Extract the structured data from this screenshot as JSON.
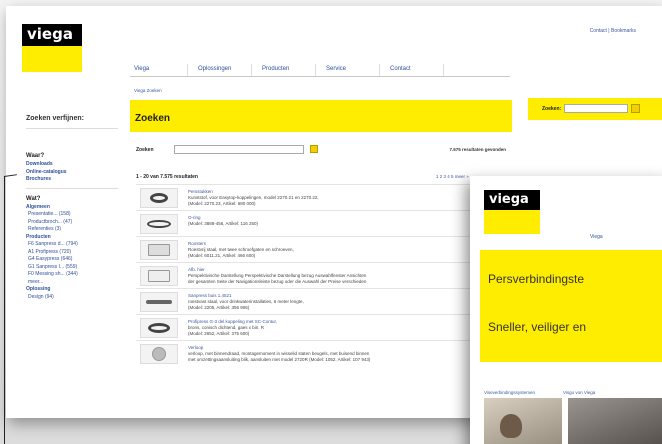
{
  "toplinks": "Contact | Bookmarks",
  "nav": [
    "Viega",
    "Oplossingen",
    "Producten",
    "Service",
    "Contact"
  ],
  "breadcrumb": "Viega Zoeken",
  "sidebar": {
    "heading": "Zoeken verfijnen:"
  },
  "band": {
    "title": "Zoeken",
    "right_label": "Zoeken:"
  },
  "search": {
    "label": "Zoeken",
    "result_count": "7.575 resultaten gevonden"
  },
  "results_header": {
    "range": "1 - 20 van 7.575 resultaten",
    "pager": "1 2 3 4 5 meer »"
  },
  "results": [
    {
      "title": "Persstukken",
      "desc": "Kunststof, voor Easytop-koppelingen, model 2270.21 en 2270.22,",
      "desc2": "(Model: 2270.23, Artikel: 680 000)"
    },
    {
      "title": "O-ring",
      "desc": "(Model: 3888-456, Artikel: 116 250)",
      "desc2": ""
    },
    {
      "title": "Roosters",
      "desc": "Roestvrij staal, met twee schroefgaten en schroeven,",
      "desc2": "(Model: 6011.21, Artikel: 466 600)"
    },
    {
      "title": "Afb. hier",
      "desc": "Perspektivische Darstellung Perspektivische Darstellung bezug Auswahlfenster Ansichten",
      "desc2": "der gesamten Seite der Navigationsleiste bezug oder die Auswahl der Preise verschieden"
    },
    {
      "title": "Sanpress buis 1.4521",
      "desc": "roestvast staal, voor drinkwaterinstallaties, 6 meter lengte,",
      "desc2": "(Model: 2205, Artikel: 356 906)"
    },
    {
      "title": "Profipress G-3 del koppeling met SC-Contur,",
      "desc": "brons, conisch dichtend, gaes x bin. R",
      "desc2": "(Model: 2652, Artikel: 375 600)"
    },
    {
      "title": "Verloop",
      "desc": "verloop, met binnendraad, montagemoment in wisselid staten beugels, met buisend binnen",
      "desc2": "met omzettingsaansluiting blik, aansluiten met model 2720R (Model: 1052, Artikel: 107 943)"
    }
  ],
  "filters": {
    "where_heading": "Waar?",
    "where_links": [
      "Downloads",
      "Online-catalogus",
      "Brochures"
    ],
    "what_heading": "Wat?",
    "groups": [
      {
        "name": "Algemeen",
        "items": [
          "Presentatie... (158)",
          "Productbroch... (47)",
          "Referenties (3)"
        ]
      },
      {
        "name": "Producten",
        "items": [
          "F6 Sanpress d... (794)",
          "A1 Profipress (720)",
          "G4 Easypress (646)",
          "G1 Sanpress I... (559)",
          "F0 Messing sh... (344)",
          "meer..."
        ]
      },
      {
        "name": "Oplossing",
        "items": [
          "Design (94)"
        ]
      }
    ]
  },
  "front": {
    "logo": "viega",
    "nav": "Viega",
    "line1": "Persverbindingste",
    "line2": "Sneller, veiliger en",
    "tab1": "Viseverbindingssystemen",
    "tab2": "Visgo von Viega"
  },
  "logo": "viega",
  "colors": {
    "brand_yellow": "#ffed00",
    "link_blue": "#2f4f9a"
  }
}
